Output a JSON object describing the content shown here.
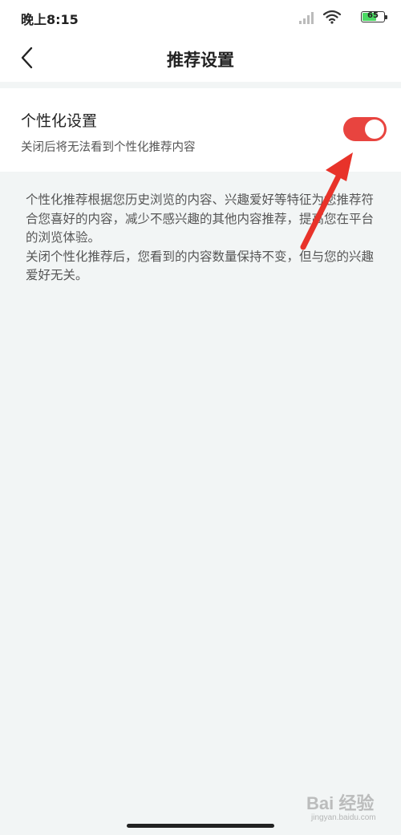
{
  "status_bar": {
    "time": "晚上8:15",
    "battery": "65",
    "icons": [
      "signal-icon",
      "wifi-icon",
      "battery-icon"
    ]
  },
  "header": {
    "title": "推荐设置",
    "back_icon": "chevron-left-icon"
  },
  "setting": {
    "title": "个性化设置",
    "description": "关闭后将无法看到个性化推荐内容",
    "enabled": true,
    "toggle_color": "#e8443f"
  },
  "info": {
    "paragraph1": "个性化推荐根据您历史浏览的内容、兴趣爱好等特征为您推荐符合您喜好的内容，减少不感兴趣的其他内容推荐，提高您在平台的浏览体验。",
    "paragraph2": "关闭个性化推荐后，您看到的内容数量保持不变，但与您的兴趣爱好无关。"
  },
  "watermark": {
    "text": "Bai 经验",
    "sub": "jingyan.baidu.com"
  },
  "colors": {
    "background": "#f2f5f5",
    "card": "#ffffff",
    "accent": "#e8443f",
    "annotation_arrow": "#e8332a"
  }
}
